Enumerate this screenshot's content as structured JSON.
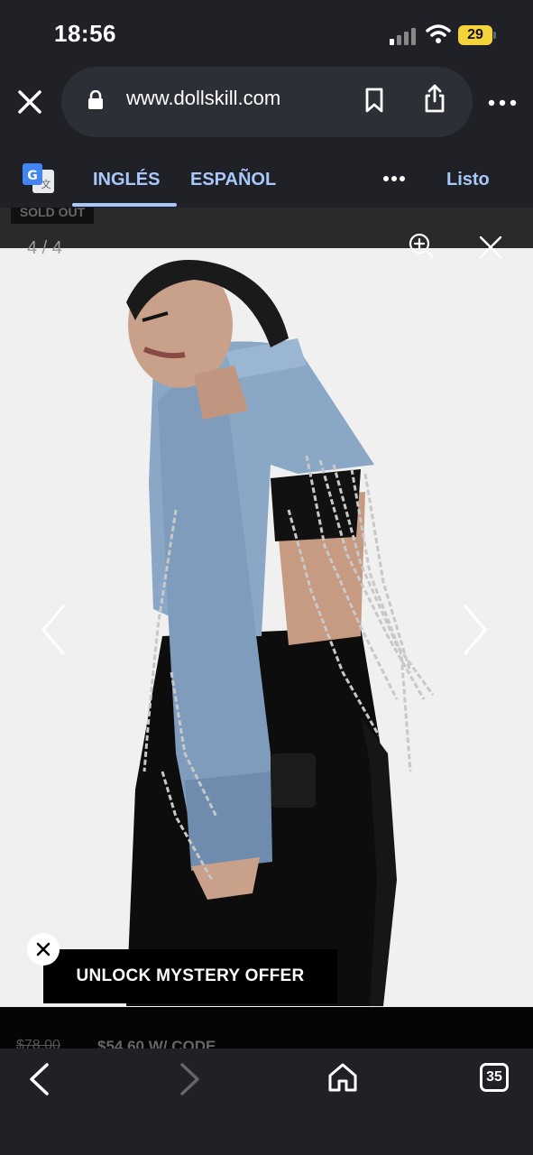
{
  "status_bar": {
    "time": "18:56",
    "battery_level": "29"
  },
  "browser": {
    "url": "www.dollskill.com",
    "translate": {
      "language_active": "INGLÉS",
      "language_other": "ESPAÑOL",
      "done_label": "Listo"
    }
  },
  "viewer": {
    "counter": "4 / 4",
    "sold_out_label": "SOLD OUT"
  },
  "product": {
    "old_price": "$78.00",
    "promo_price": "$54.60 W/ CODE"
  },
  "offer": {
    "label": "UNLOCK MYSTERY OFFER"
  },
  "bottom_nav": {
    "tab_count": "35"
  },
  "icons": [
    "close-icon",
    "lock-icon",
    "bookmark-icon",
    "share-icon",
    "more-icon",
    "google-translate-icon",
    "zoom-in-icon",
    "chevron-left-icon",
    "chevron-right-icon",
    "home-icon",
    "tabs-icon"
  ],
  "colors": {
    "chrome_bg": "#1f2126",
    "link_blue": "#a8c7fa",
    "battery": "#f4d33b",
    "photo_bg": "#f0f0f0"
  }
}
